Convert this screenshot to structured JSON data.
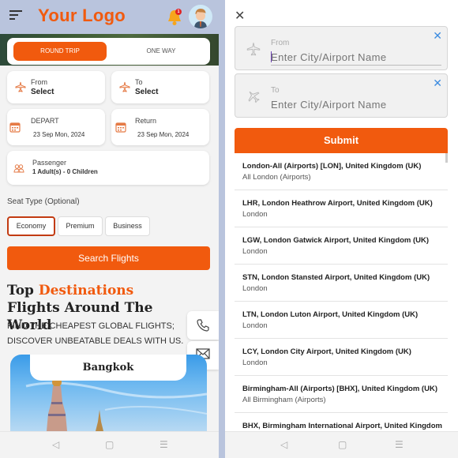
{
  "left": {
    "header": {
      "logo": "Your Logo",
      "notification_count": "1"
    },
    "trip_type": {
      "options": [
        "ROUND TRIP",
        "ONE WAY"
      ],
      "selected": "ROUND TRIP"
    },
    "from": {
      "label": "From",
      "value": "Select"
    },
    "to": {
      "label": "To",
      "value": "Select"
    },
    "depart": {
      "label": "DEPART",
      "value": "23 Sep Mon, 2024"
    },
    "return": {
      "label": "Return",
      "value": "23 Sep Mon, 2024"
    },
    "passenger": {
      "label": "Passenger",
      "value": "1 Adult(s) - 0 Children"
    },
    "seat_type": {
      "label": "Seat Type (Optional)",
      "options": [
        "Economy",
        "Premium",
        "Business"
      ],
      "selected": "Economy"
    },
    "search_button": "Search Flights",
    "destinations": {
      "title_part1": "Top ",
      "title_accent": "Destinations",
      "title_part2": " Flights Around The World",
      "subtitle": "FIND THE CHEAPEST GLOBAL FLIGHTS; DISCOVER UNBEATABLE DEALS WITH US.",
      "card_city": "Bangkok"
    }
  },
  "right": {
    "from_field": {
      "label": "From",
      "placeholder": "Enter City/Airport Name",
      "value": ""
    },
    "to_field": {
      "label": "To",
      "placeholder": "Enter City/Airport Name",
      "value": ""
    },
    "submit_button": "Submit",
    "suggestions": [
      {
        "title": "London-All (Airports) [LON], United Kingdom (UK)",
        "subtitle": "All London (Airports)"
      },
      {
        "title": "LHR, London Heathrow Airport, United Kingdom (UK)",
        "subtitle": "London"
      },
      {
        "title": "LGW, London Gatwick Airport, United Kingdom (UK)",
        "subtitle": "London"
      },
      {
        "title": "STN, London Stansted Airport, United Kingdom (UK)",
        "subtitle": "London"
      },
      {
        "title": "LTN, London Luton Airport, United Kingdom (UK)",
        "subtitle": "London"
      },
      {
        "title": "LCY, London City Airport, United Kingdom (UK)",
        "subtitle": "London"
      },
      {
        "title": "Birmingham-All (Airports) [BHX], United Kingdom (UK)",
        "subtitle": "All Birmingham (Airports)"
      },
      {
        "title": "BHX, Birmingham International Airport, United Kingdom",
        "subtitle": ""
      }
    ]
  },
  "colors": {
    "accent": "#f15a0e",
    "header_bg": "#b9c4dd",
    "clear_icon": "#3b8be0"
  },
  "icons": {
    "menu": "hamburger-icon",
    "notification": "bell-icon",
    "profile": "avatar",
    "plane": "plane-icon",
    "calendar": "calendar-icon",
    "passenger": "users-icon",
    "phone": "phone-icon",
    "mail": "mail-icon",
    "close": "close-icon",
    "nav_back": "back-triangle-icon",
    "nav_home": "home-square-icon",
    "nav_menu": "menu-lines-icon"
  }
}
